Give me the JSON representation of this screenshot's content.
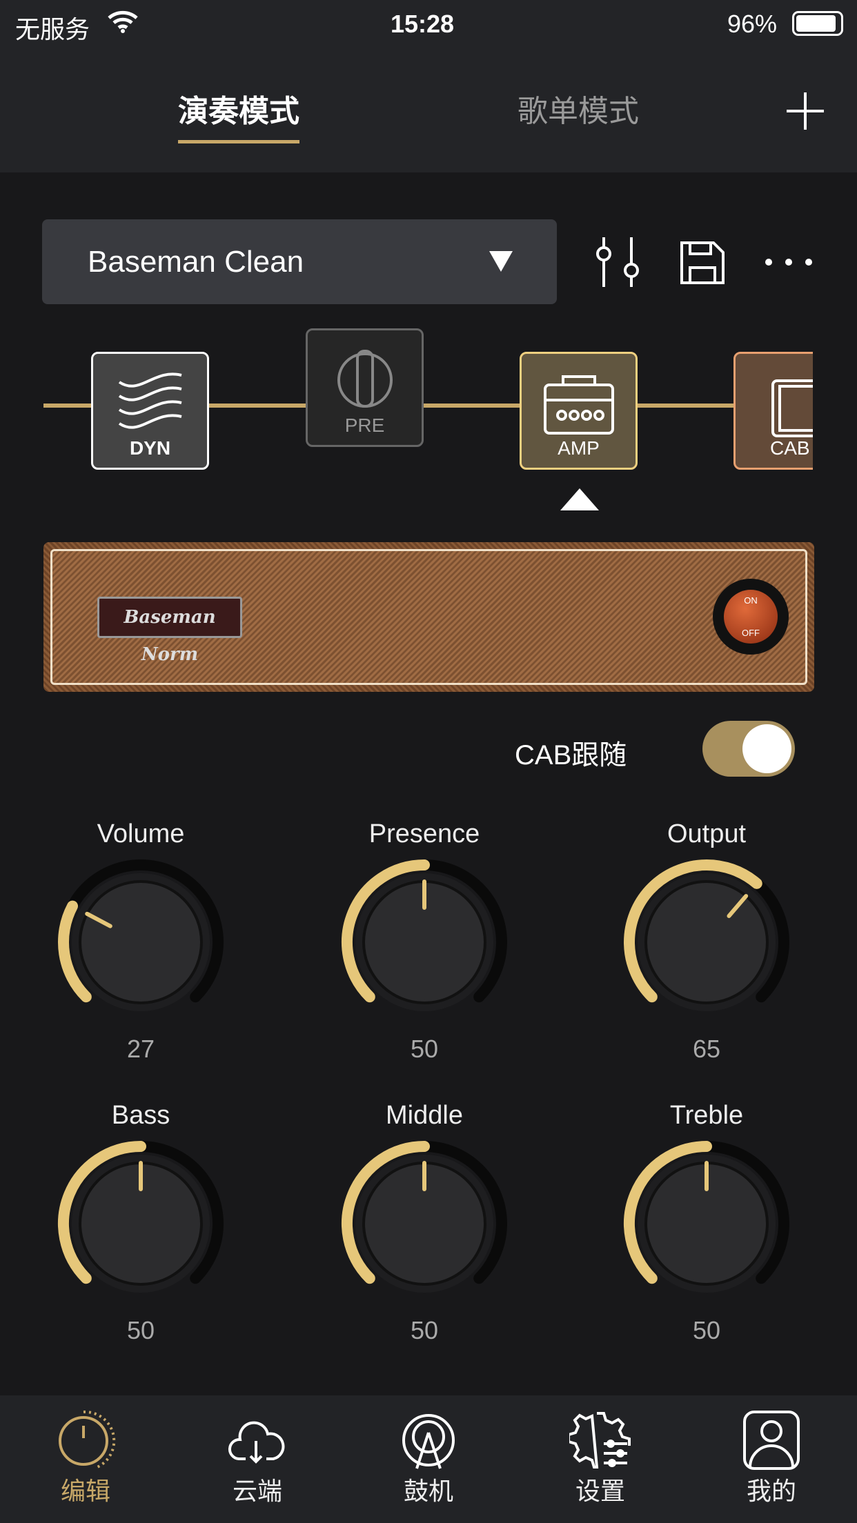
{
  "status": {
    "carrier": "无服务",
    "time": "15:28",
    "battery": "96%"
  },
  "header": {
    "tabs": [
      {
        "label": "演奏模式",
        "active": true
      },
      {
        "label": "歌单模式",
        "active": false
      }
    ],
    "add_icon": "plus-icon"
  },
  "preset": {
    "name": "Baseman Clean",
    "icons": [
      "mixer-sliders-icon",
      "save-icon",
      "more-icon"
    ]
  },
  "chain": [
    {
      "label": "DYN"
    },
    {
      "label": "PRE"
    },
    {
      "label": "AMP",
      "selected": true
    },
    {
      "label": "CAB"
    }
  ],
  "amp": {
    "badge": "Baseman Norm",
    "switch_on": "ON",
    "switch_off": "OFF"
  },
  "cab_follow": {
    "label": "CAB跟随",
    "on": true
  },
  "knobs": [
    {
      "label": "Volume",
      "value": 27
    },
    {
      "label": "Presence",
      "value": 50
    },
    {
      "label": "Output",
      "value": 65
    },
    {
      "label": "Bass",
      "value": 50
    },
    {
      "label": "Middle",
      "value": 50
    },
    {
      "label": "Treble",
      "value": 50
    }
  ],
  "colors": {
    "accent": "#c8a868",
    "knob_arc": "#e6c77a"
  },
  "nav": [
    {
      "label": "编辑",
      "icon": "knob-icon",
      "active": true
    },
    {
      "label": "云端",
      "icon": "cloud-download-icon"
    },
    {
      "label": "鼓机",
      "icon": "drum-icon"
    },
    {
      "label": "设置",
      "icon": "settings-gear-icon"
    },
    {
      "label": "我的",
      "icon": "user-profile-icon"
    }
  ]
}
